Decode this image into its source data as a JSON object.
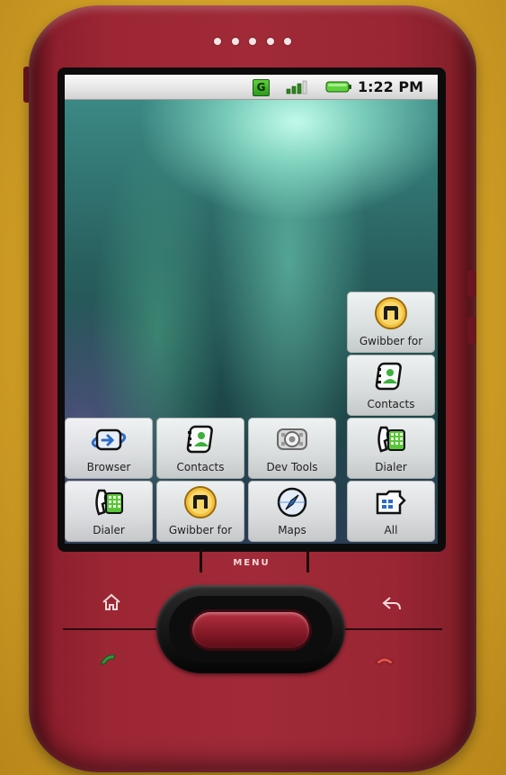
{
  "status_bar": {
    "network_type": "G",
    "time": "1:22 PM"
  },
  "hardware": {
    "menu_label": "MENU"
  },
  "home_screen": {
    "shortcuts": [
      {
        "label": "Gwibber for",
        "icon": "gwibber-icon"
      },
      {
        "label": "Contacts",
        "icon": "contacts-icon"
      },
      {
        "label": "Browser",
        "icon": "browser-icon"
      },
      {
        "label": "Contacts",
        "icon": "contacts-icon"
      },
      {
        "label": "Dev Tools",
        "icon": "dev-tools-icon"
      },
      {
        "label": "Dialer",
        "icon": "dialer-icon"
      },
      {
        "label": "Dialer",
        "icon": "dialer-icon"
      },
      {
        "label": "Gwibber for",
        "icon": "gwibber-icon"
      },
      {
        "label": "Maps",
        "icon": "maps-icon"
      },
      {
        "label": "All",
        "icon": "all-apps-icon"
      }
    ]
  },
  "colors": {
    "phone_body": "#9c2634",
    "background": "#d3a227",
    "trackball_center": "#b63141"
  }
}
